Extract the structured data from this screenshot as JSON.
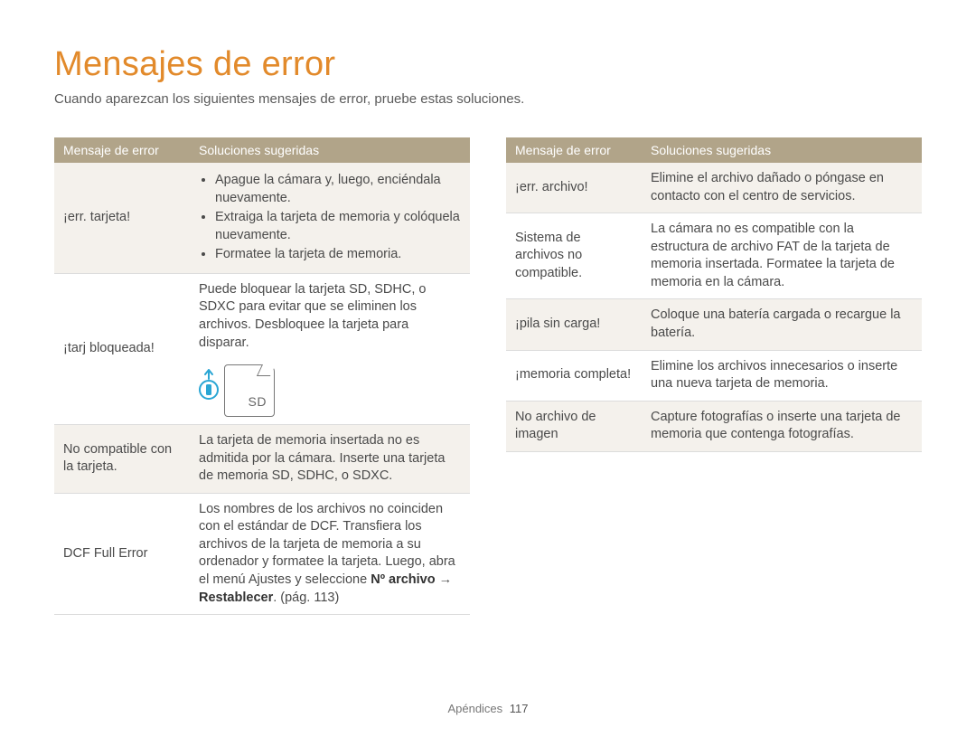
{
  "title": "Mensajes de error",
  "intro": "Cuando aparezcan los siguientes mensajes de error, pruebe estas soluciones.",
  "headers": {
    "col1": "Mensaje de error",
    "col2": "Soluciones sugeridas"
  },
  "left_rows": [
    {
      "error": "¡err. tarjeta!",
      "bullets": [
        "Apague la cámara y, luego, enciéndala nuevamente.",
        "Extraiga la tarjeta de memoria y colóquela nuevamente.",
        "Formatee la tarjeta de memoria."
      ],
      "odd": true
    },
    {
      "error": "¡tarj bloqueada!",
      "desc": "Puede bloquear la tarjeta SD, SDHC, o SDXC para evitar que se eliminen los archivos. Desbloquee la tarjeta para disparar.",
      "sd_label": "SD",
      "odd": false
    },
    {
      "error": "No compatible con la tarjeta.",
      "desc": "La tarjeta de memoria insertada no es admitida por la cámara. Inserte una tarjeta de memoria SD, SDHC, o SDXC.",
      "odd": true
    },
    {
      "error": "DCF Full Error",
      "desc_prefix": "Los nombres de los archivos no coinciden con el estándar de DCF. Transfiera los archivos de la tarjeta de memoria a su ordenador y formatee la tarjeta. Luego, abra el menú Ajustes y seleccione ",
      "bold1": "Nº archivo",
      "arrow": " → ",
      "bold2": "Restablecer",
      "desc_suffix": ". (pág. 113)",
      "odd": false
    }
  ],
  "right_rows": [
    {
      "error": "¡err. archivo!",
      "desc": "Elimine el archivo dañado o póngase en contacto con el centro de servicios.",
      "odd": true
    },
    {
      "error": "Sistema de archivos no compatible.",
      "desc": "La cámara no es compatible con la estructura de archivo FAT de la tarjeta de memoria insertada. Formatee la tarjeta de memoria en la cámara.",
      "odd": false
    },
    {
      "error": "¡pila sin carga!",
      "desc": "Coloque una batería cargada o recargue la batería.",
      "odd": true
    },
    {
      "error": "¡memoria completa!",
      "desc": "Elimine los archivos innecesarios o inserte una nueva tarjeta de memoria.",
      "odd": false
    },
    {
      "error": "No archivo de imagen",
      "desc": "Capture fotografías o inserte una tarjeta de memoria que contenga fotografías.",
      "odd": true
    }
  ],
  "footer": {
    "section": "Apéndices",
    "page": "117"
  }
}
